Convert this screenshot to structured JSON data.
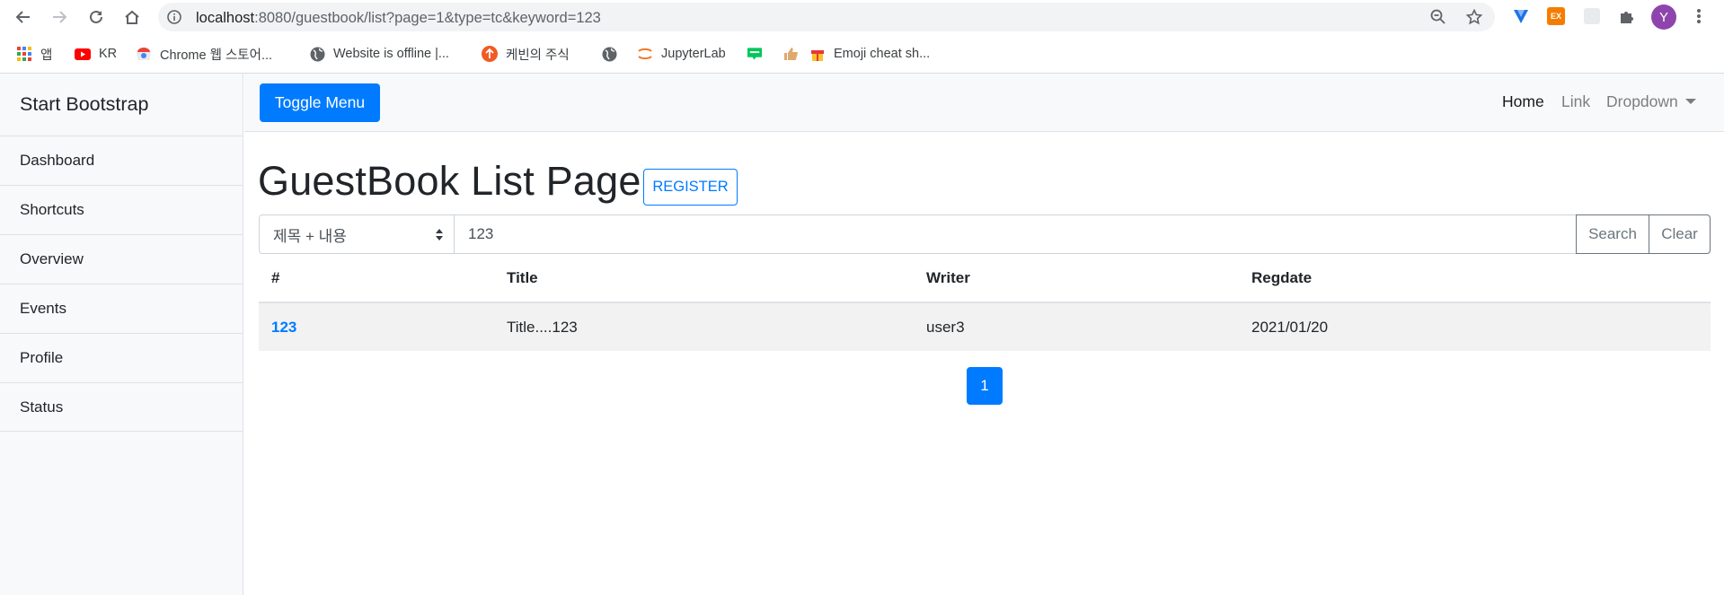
{
  "browser": {
    "url_host": "localhost",
    "url_path": ":8080/guestbook/list?page=1&type=tc&keyword=123",
    "avatar_letter": "Y",
    "ext_badge": "EX"
  },
  "bookmarks": [
    {
      "label": "앱",
      "icon": "apps-grid-icon"
    },
    {
      "label": "KR",
      "icon": "youtube-icon"
    },
    {
      "label": "Chrome 웹 스토어...",
      "icon": "chrome-webstore-icon"
    },
    {
      "label": "Website is offline |...",
      "icon": "globe-icon"
    },
    {
      "label": "케빈의 주식",
      "icon": "brand-icon"
    },
    {
      "label": "",
      "icon": "globe-icon"
    },
    {
      "label": "JupyterLab",
      "icon": "jupyter-icon"
    },
    {
      "label": "",
      "icon": "blog-icon"
    },
    {
      "label": "",
      "icon": "thumbs-up-icon"
    },
    {
      "label": "Emoji cheat sh...",
      "icon": "gift-icon"
    }
  ],
  "sidebar": {
    "heading": "Start Bootstrap",
    "items": [
      "Dashboard",
      "Shortcuts",
      "Overview",
      "Events",
      "Profile",
      "Status"
    ]
  },
  "navbar": {
    "toggle_label": "Toggle Menu",
    "links": {
      "home": "Home",
      "link": "Link",
      "dropdown": "Dropdown"
    }
  },
  "main": {
    "title": "GuestBook List Page",
    "register_label": "REGISTER",
    "search": {
      "type_selected": "제목 + 내용",
      "keyword": "123",
      "search_label": "Search",
      "clear_label": "Clear"
    },
    "table": {
      "headers": [
        "#",
        "Title",
        "Writer",
        "Regdate"
      ],
      "rows": [
        {
          "gno": "123",
          "title": "Title....123",
          "writer": "user3",
          "regdate": "2021/01/20"
        }
      ]
    },
    "pagination": {
      "current": "1"
    }
  },
  "colors": {
    "primary": "#007bff",
    "sidebar_bg": "#f8f9fa",
    "row_stripe": "#f2f2f2"
  }
}
